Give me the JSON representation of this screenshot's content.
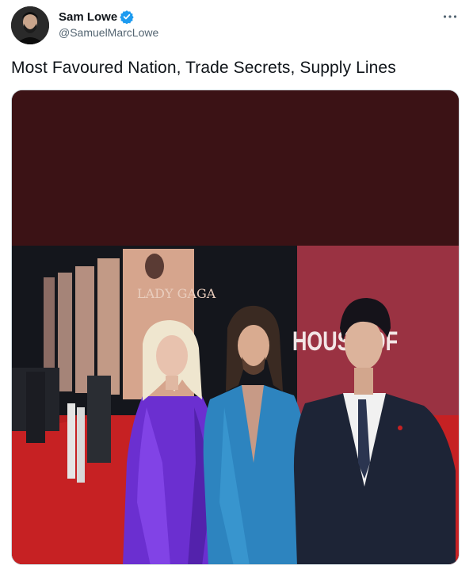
{
  "tweet": {
    "author": {
      "display_name": "Sam Lowe",
      "handle": "@SamuelMarcLowe",
      "verified": true,
      "avatar_icon": "profile-photo"
    },
    "more_icon": "more-horizontal-icon",
    "text": "Most Favoured Nation, Trade Secrets, Supply Lines",
    "media": {
      "kind": "photo",
      "background_text_1": "LADY GAGA",
      "background_text_2": "HOUSE OF"
    }
  },
  "colors": {
    "verified_blue": "#1d9bf0",
    "handle_gray": "#536471",
    "media_top_band": "#3b1215",
    "carpet_red": "#b81d1f"
  }
}
